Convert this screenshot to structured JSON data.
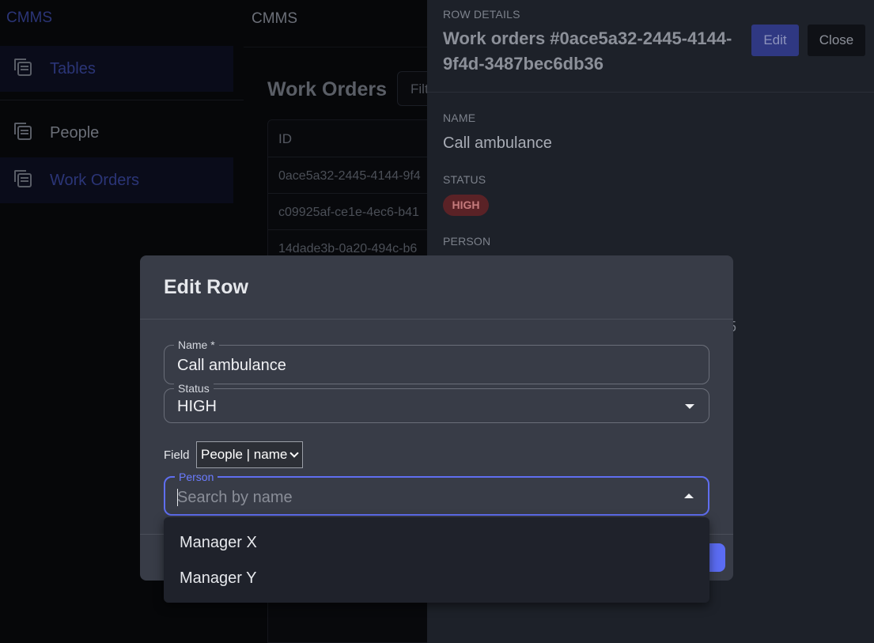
{
  "sidebar": {
    "brand": "CMMS",
    "items": [
      {
        "label": "Tables",
        "icon": "table-icon",
        "active": true
      },
      {
        "label": "People",
        "icon": "table-icon",
        "active": false
      },
      {
        "label": "Work Orders",
        "icon": "table-icon",
        "active": true
      }
    ]
  },
  "header": {
    "title": "CMMS"
  },
  "main": {
    "page_title": "Work Orders",
    "filter_placeholder": "Filt",
    "table": {
      "columns": [
        "ID"
      ],
      "rows": [
        "0ace5a32-2445-4144-9f4",
        "c09925af-ce1e-4ec6-b41",
        "14dade3b-0a20-494c-b6"
      ]
    }
  },
  "row_details": {
    "section_label": "ROW DETAILS",
    "title": "Work orders #0ace5a32-2445-4144-9f4d-3487bec6db36",
    "edit_label": "Edit",
    "close_label": "Close",
    "name_label": "NAME",
    "name_value": "Call ambulance",
    "status_label": "STATUS",
    "status_value": "HIGH",
    "person_label": "PERSON",
    "person_peek": "5"
  },
  "modal": {
    "title": "Edit Row",
    "name_field": {
      "label": "Name *",
      "value": "Call ambulance"
    },
    "status_field": {
      "label": "Status",
      "value": "HIGH"
    },
    "field_selector": {
      "label": "Field",
      "value": "People | name"
    },
    "person_field": {
      "label": "Person",
      "placeholder": "Search by name"
    },
    "options": [
      "Manager X",
      "Manager Y"
    ]
  },
  "colors": {
    "accent": "#5b6cf3",
    "badge_bg": "#5a2226",
    "modal_bg": "#383c47",
    "panel_bg": "#1d2129"
  }
}
